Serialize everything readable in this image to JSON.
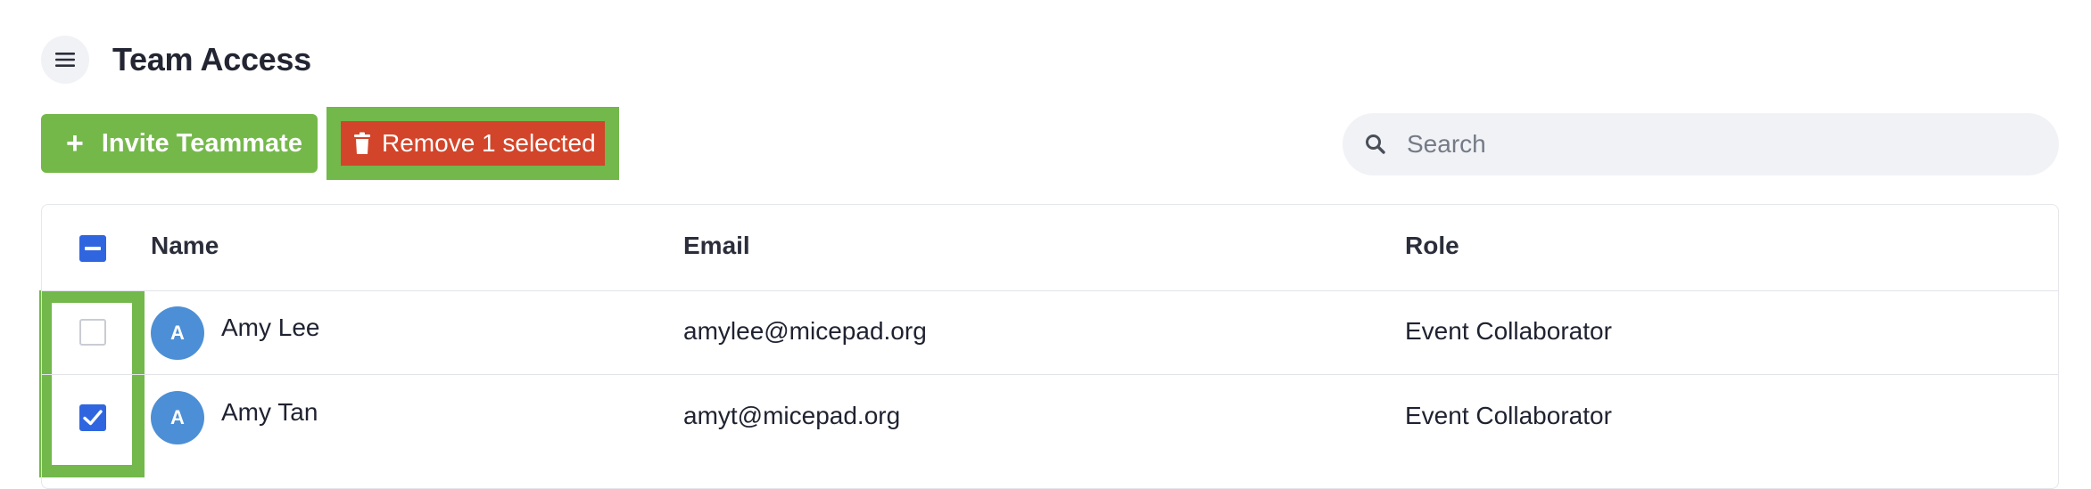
{
  "header": {
    "title": "Team Access",
    "menu_icon": "hamburger-icon"
  },
  "toolbar": {
    "invite_icon": "+",
    "invite_label": "Invite Teammate",
    "remove_icon": "trash-icon",
    "remove_label": "Remove 1 selected"
  },
  "search": {
    "placeholder": "Search",
    "value": "",
    "icon": "search-icon"
  },
  "table": {
    "select_all_state": "indeterminate",
    "columns": [
      "Name",
      "Email",
      "Role"
    ],
    "rows": [
      {
        "checked": false,
        "avatar": "A",
        "name": "Amy Lee",
        "email": "amylee@micepad.org",
        "role": "Event Collaborator"
      },
      {
        "checked": true,
        "avatar": "A",
        "name": "Amy Tan",
        "email": "amyt@micepad.org",
        "role": "Event Collaborator"
      }
    ]
  },
  "colors": {
    "primary_green": "#74b84a",
    "danger_red": "#d2452a",
    "checkbox_blue": "#2f66e0",
    "avatar_blue": "#4c8fd6",
    "highlight_green": "#72b84b"
  }
}
